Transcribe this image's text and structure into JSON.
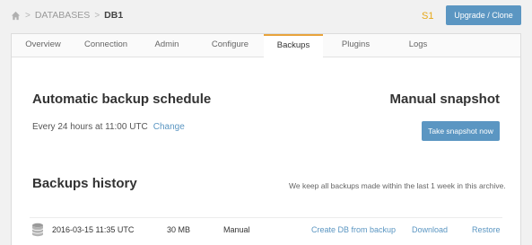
{
  "breadcrumb": {
    "items": [
      "DATABASES",
      "DB1"
    ]
  },
  "header": {
    "tier": "S1",
    "upgrade_label": "Upgrade / Clone"
  },
  "tabs": [
    {
      "label": "Overview"
    },
    {
      "label": "Connection"
    },
    {
      "label": "Admin"
    },
    {
      "label": "Configure"
    },
    {
      "label": "Backups",
      "active": true
    },
    {
      "label": "Plugins"
    },
    {
      "label": "Logs"
    }
  ],
  "automatic": {
    "title": "Automatic backup schedule",
    "schedule": "Every 24 hours at 11:00 UTC",
    "change_label": "Change"
  },
  "manual": {
    "title": "Manual snapshot",
    "button_label": "Take snapshot now"
  },
  "history": {
    "title": "Backups history",
    "note": "We keep all backups made within the last 1 week in this archive.",
    "rows": [
      {
        "date": "2016-03-15 11:35 UTC",
        "size": "30 MB",
        "type": "Manual",
        "create_label": "Create DB from backup",
        "download_label": "Download",
        "restore_label": "Restore"
      }
    ]
  },
  "colors": {
    "accent": "#5b96c2",
    "tab_active_border": "#e8a33c",
    "tier": "#e6a817"
  },
  "icons": {
    "home": "home-icon",
    "database": "database-icon"
  }
}
